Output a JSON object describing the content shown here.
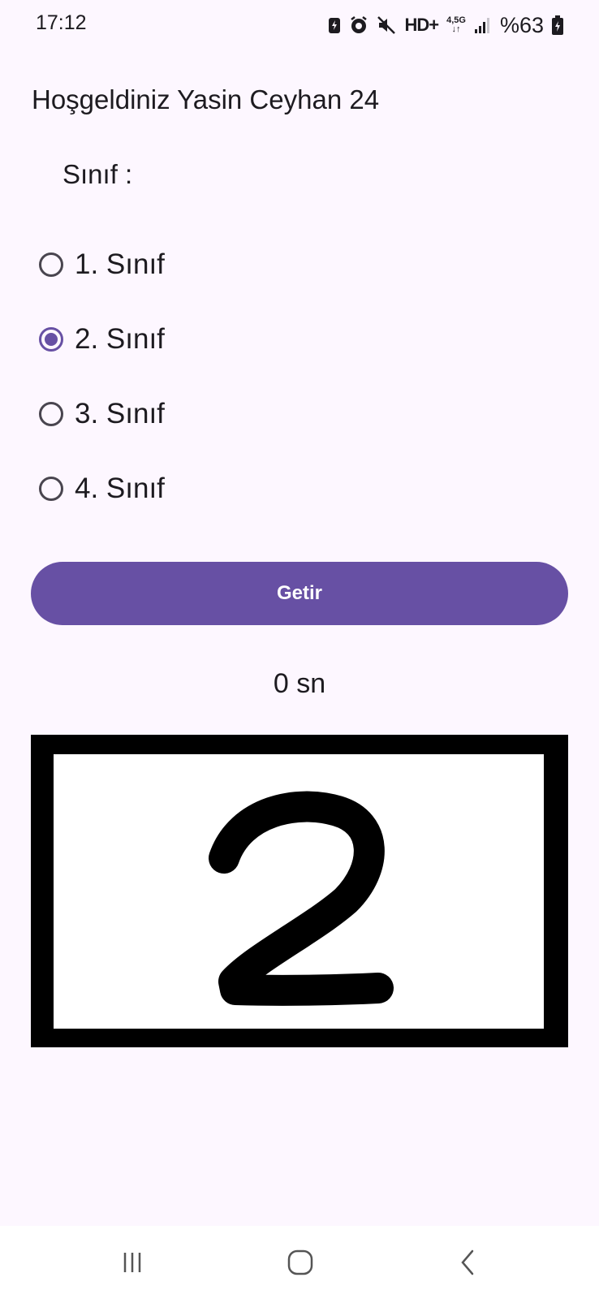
{
  "status_bar": {
    "time": "17:12",
    "network_label": "HD+",
    "network_type": "4,5G",
    "battery": "%63",
    "icons": [
      "battery-saver-icon",
      "alarm-icon",
      "mute-icon",
      "hd-plus-icon",
      "network-4-5g-icon",
      "signal-icon",
      "battery-icon"
    ]
  },
  "welcome_text": "Hoşgeldiniz Yasin Ceyhan 24",
  "class_label": "Sınıf :",
  "class_options": [
    {
      "label": "1. Sınıf",
      "checked": false
    },
    {
      "label": "2. Sınıf",
      "checked": true
    },
    {
      "label": "3. Sınıf",
      "checked": false
    },
    {
      "label": "4. Sınıf",
      "checked": false
    }
  ],
  "fetch_button": "Getir",
  "timer_text": "0 sn",
  "number_image": {
    "digit": "2"
  },
  "nav_bar": {
    "icons": [
      "recent-apps-icon",
      "home-icon",
      "back-icon"
    ]
  },
  "colors": {
    "background": "#fdf7ff",
    "accent": "#6750a4",
    "text": "#1d1b20"
  }
}
